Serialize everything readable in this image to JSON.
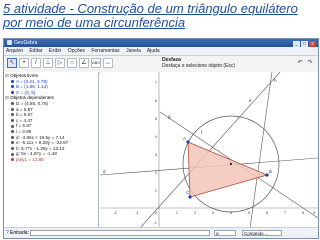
{
  "slide": {
    "title": "5 atividade - Construção de um triângulo equilátero por meio de uma circunferência"
  },
  "window": {
    "title": "GeoGebra",
    "controls": [
      "_",
      "□",
      "x"
    ]
  },
  "menu": [
    "Arquivo",
    "Editar",
    "Exibir",
    "Opções",
    "Ferramentas",
    "Janela",
    "Ajuda"
  ],
  "toolbar": {
    "tools": [
      "↖",
      "•",
      "/",
      "⊥",
      "▷",
      "○",
      "∠",
      "ABC",
      "↔"
    ],
    "help_title": "Desfaza",
    "help_text": "Desfaça e selecione objeto (Esc)"
  },
  "algebra": {
    "free_group": "Objetos livres",
    "free": [
      "A = (0.21, 4.78)",
      "B = (1.86, 1.14)",
      "C = (0, 5)"
    ],
    "dep_group": "Objetos dependentes",
    "dependent": [
      "D = (4.86, 0.78)",
      "a = 5.57",
      "b = 5.57",
      "c = 4.47",
      "f = 5.87",
      "i = 3.99",
      "d: -4.86x + 19.5y = 7.14",
      "e: -5.11x + 8.29y = -22.97",
      "h: 5.77x - 1.36y = 13.13",
      "g: 5x - 4.87y = -1.48",
      "poly1 = 13.88"
    ],
    "red_items": [
      "poly1 = 13.88"
    ]
  },
  "axes": {
    "x_ticks": [
      "-2",
      "-1",
      "0",
      "1",
      "2",
      "3",
      "4",
      "5",
      "6",
      "7",
      "8",
      "9"
    ],
    "y_ticks": [
      "7",
      "6",
      "5",
      "4",
      "3",
      "2",
      "1",
      "-1"
    ],
    "point_labels": [
      "A",
      "B",
      "C"
    ],
    "line_labels": [
      "d",
      "e",
      "f",
      "g",
      "h"
    ]
  },
  "colors": {
    "triangle_fill": "#f2c6b8",
    "triangle_stroke": "#b0503a",
    "point_color": "#1a3fbf",
    "line_color": "#555555",
    "title_color": "#1f4e9a"
  },
  "inputbar": {
    "label": "Entrada:",
    "symbol_dropdown": "α",
    "command_dropdown": "Comando ..."
  }
}
